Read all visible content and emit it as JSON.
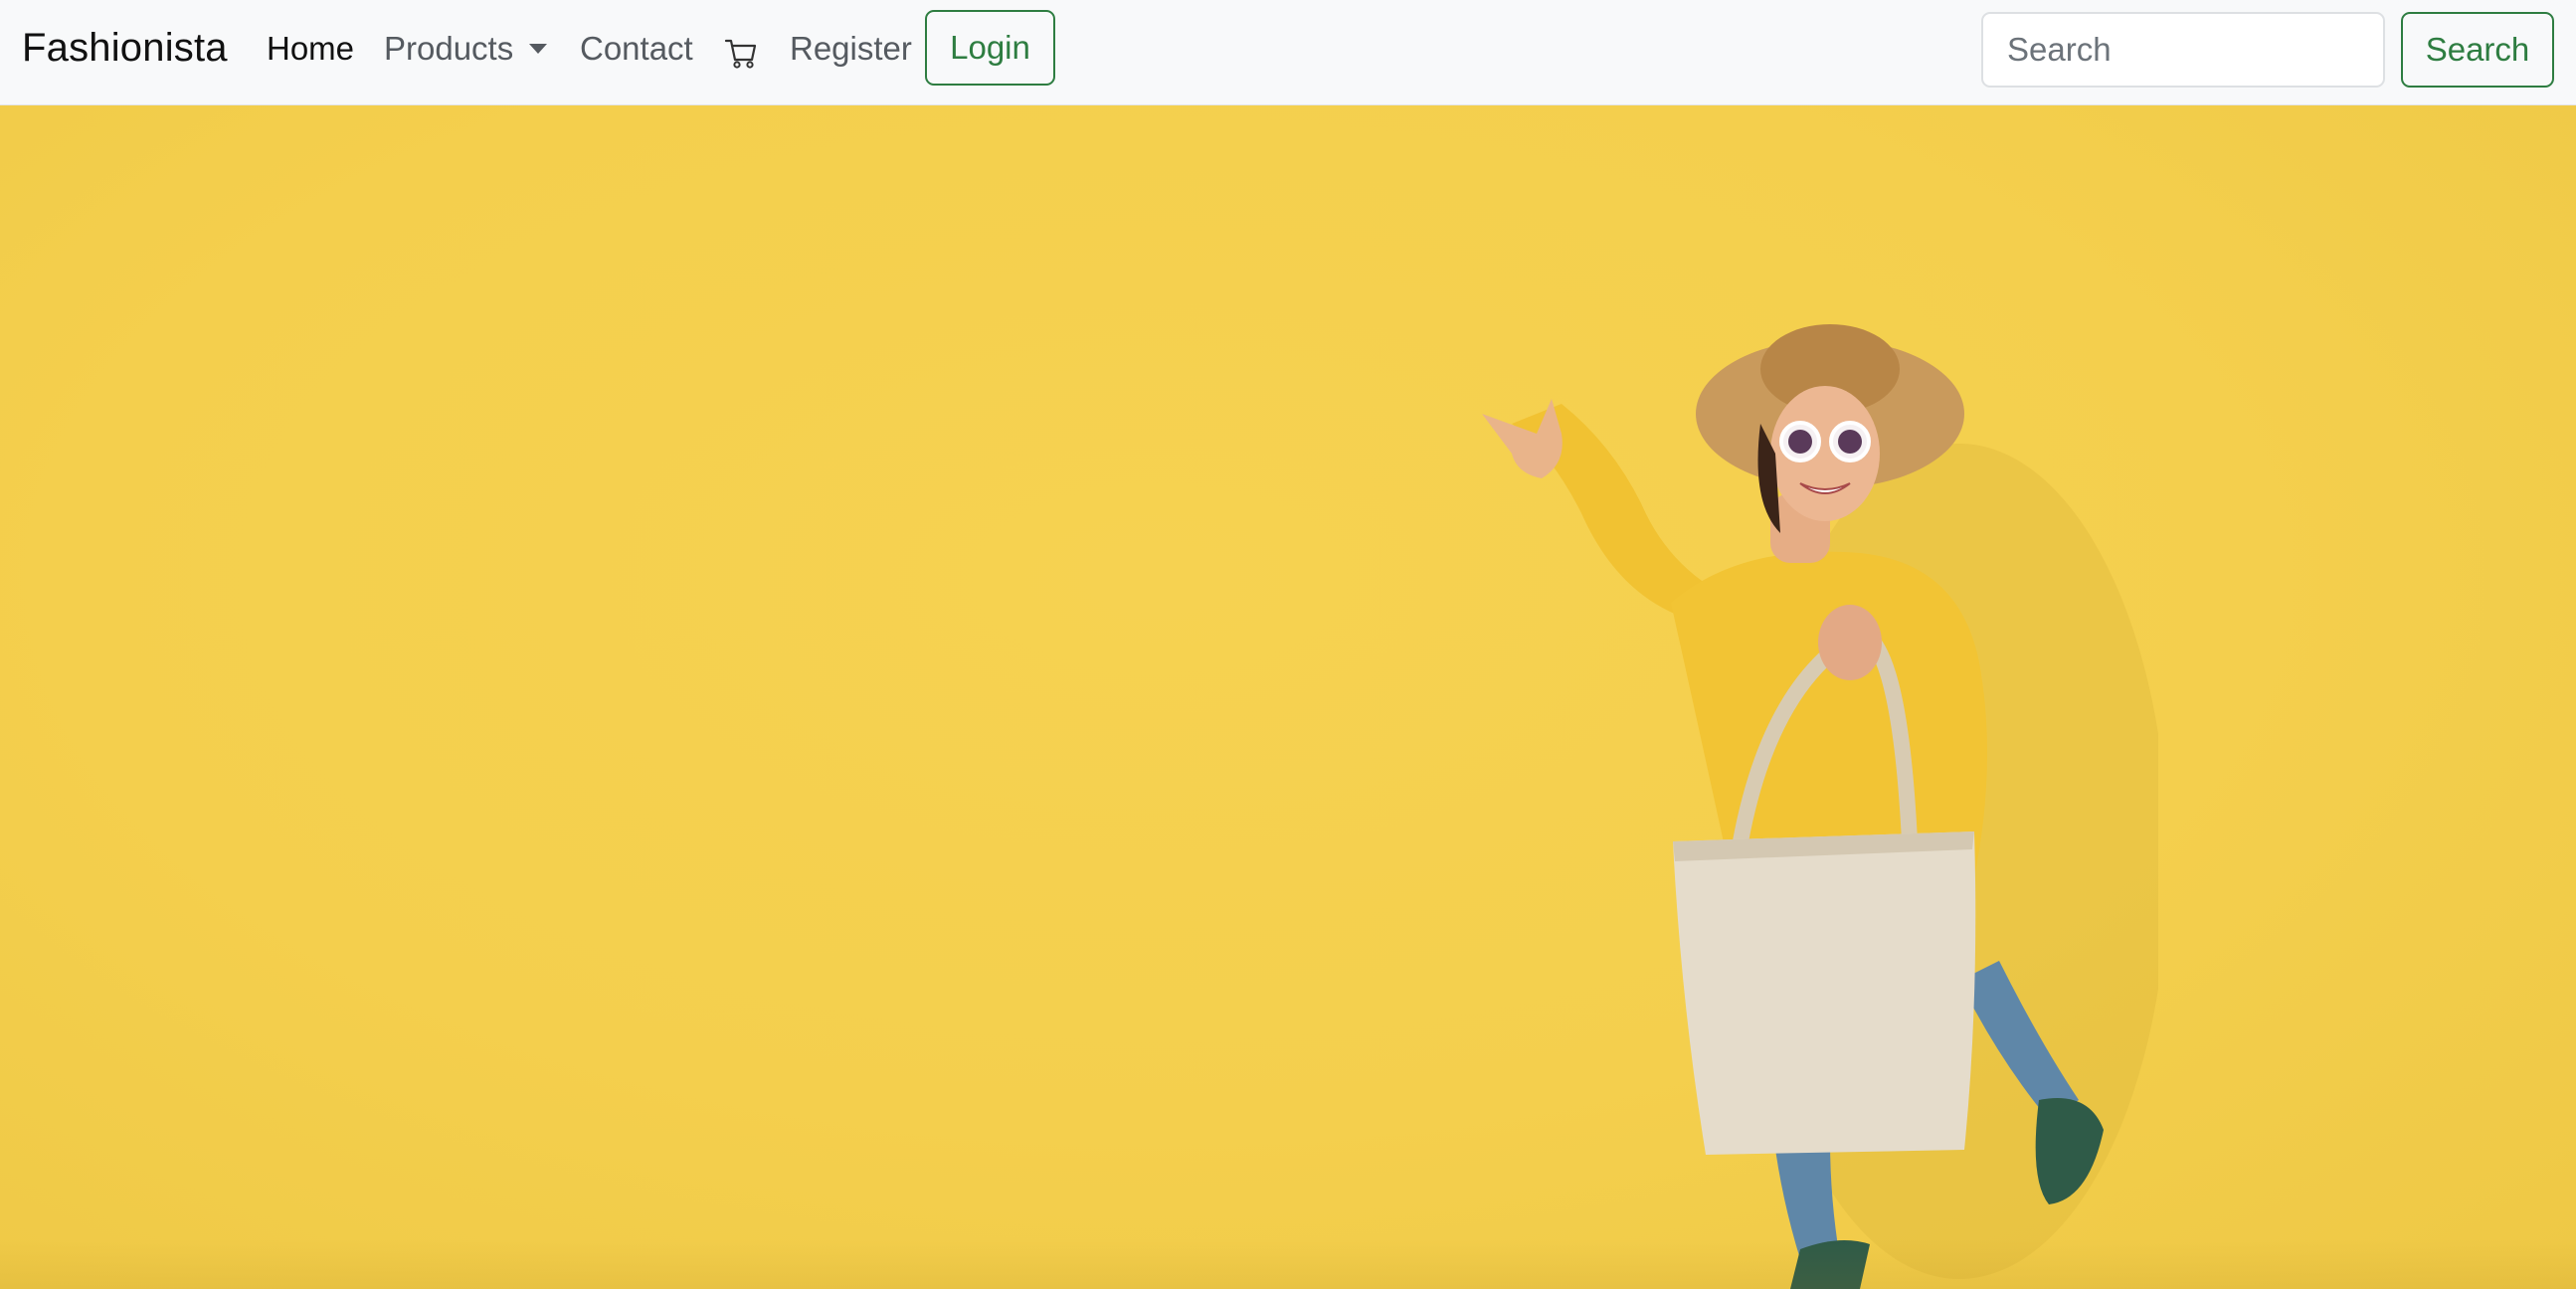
{
  "navbar": {
    "brand": "Fashionista",
    "links": {
      "home": "Home",
      "products": "Products",
      "contact": "Contact",
      "register": "Register"
    },
    "cart_icon": "cart-icon",
    "login_label": "Login",
    "search": {
      "placeholder": "Search",
      "value": "",
      "button_label": "Search"
    }
  },
  "hero": {
    "background_color": "#f4cf4d",
    "image_subject": "woman-with-tote-bag"
  },
  "colors": {
    "accent_green": "#2e7d41",
    "navbar_bg": "#f8f9fa"
  }
}
